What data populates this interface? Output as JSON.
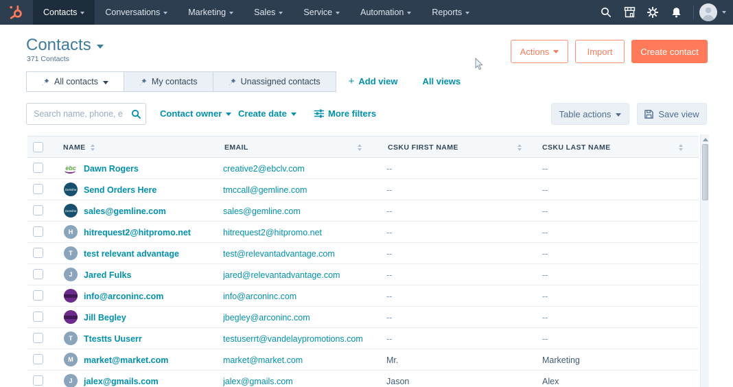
{
  "colors": {
    "nav_bg": "#2d3e50",
    "nav_active_bg": "#1e2d3c",
    "brand_orange": "#ff7a59",
    "link_teal": "#0091ae",
    "title_blue": "#3e7b9c",
    "header_text": "#33475b",
    "table_header_bg": "#f5f8fa"
  },
  "nav": {
    "items": [
      {
        "label": "Contacts",
        "active": true
      },
      {
        "label": "Conversations",
        "active": false
      },
      {
        "label": "Marketing",
        "active": false
      },
      {
        "label": "Sales",
        "active": false
      },
      {
        "label": "Service",
        "active": false
      },
      {
        "label": "Automation",
        "active": false
      },
      {
        "label": "Reports",
        "active": false
      }
    ],
    "right_icons": [
      "search-icon",
      "marketplace-icon",
      "settings-icon",
      "notifications-icon",
      "user-avatar"
    ]
  },
  "header": {
    "title": "Contacts",
    "subtitle": "371 Contacts",
    "actions_label": "Actions",
    "import_label": "Import",
    "create_label": "Create contact"
  },
  "tabs": {
    "items": [
      {
        "label": "All contacts",
        "active": true,
        "caret": true
      },
      {
        "label": "My contacts",
        "active": false,
        "caret": false
      },
      {
        "label": "Unassigned contacts",
        "active": false,
        "caret": false
      }
    ],
    "add_view_label": "Add view",
    "all_views_label": "All views"
  },
  "filters": {
    "search_placeholder": "Search name, phone, e",
    "contact_owner_label": "Contact owner",
    "create_date_label": "Create date",
    "more_filters_label": "More filters",
    "table_actions_label": "Table actions",
    "save_view_label": "Save view"
  },
  "table": {
    "columns": [
      "NAME",
      "EMAIL",
      "CSKU FIRST NAME",
      "CSKU LAST NAME"
    ],
    "rows": [
      {
        "name": "Dawn Rogers",
        "email": "creative2@ebclv.com",
        "first": "--",
        "last": "--",
        "avatar": {
          "type": "ebc",
          "text": "ebc"
        }
      },
      {
        "name": "Send Orders Here",
        "email": "tmccall@gemline.com",
        "first": "--",
        "last": "--",
        "avatar": {
          "type": "gemline",
          "text": "Gemline"
        }
      },
      {
        "name": "sales@gemline.com",
        "email": "sales@gemline.com",
        "first": "--",
        "last": "--",
        "avatar": {
          "type": "gemline",
          "text": "Gemline"
        }
      },
      {
        "name": "hitrequest2@hitpromo.net",
        "email": "hitrequest2@hitpromo.net",
        "first": "--",
        "last": "--",
        "avatar": {
          "type": "letter",
          "text": "H"
        }
      },
      {
        "name": "test relevant advantage",
        "email": "test@relevantadvantage.com",
        "first": "--",
        "last": "--",
        "avatar": {
          "type": "letter",
          "text": "T"
        }
      },
      {
        "name": "Jared Fulks",
        "email": "jared@relevantadvantage.com",
        "first": "--",
        "last": "--",
        "avatar": {
          "type": "letter",
          "text": "J"
        }
      },
      {
        "name": "info@arconinc.com",
        "email": "info@arconinc.com",
        "first": "--",
        "last": "--",
        "avatar": {
          "type": "arcon",
          "text": ""
        }
      },
      {
        "name": "Jill Begley",
        "email": "jbegley@arconinc.com",
        "first": "--",
        "last": "--",
        "avatar": {
          "type": "arcon",
          "text": ""
        }
      },
      {
        "name": "Ttestts Uuserr",
        "email": "testuserrt@vandelaypromotions.com",
        "first": "--",
        "last": "--",
        "avatar": {
          "type": "letter",
          "text": "T"
        }
      },
      {
        "name": "market@market.com",
        "email": "market@market.com",
        "first": "Mr.",
        "last": "Marketing",
        "avatar": {
          "type": "letter",
          "text": "M"
        }
      },
      {
        "name": "jalex@gmails.com",
        "email": "jalex@gmails.com",
        "first": "Jason",
        "last": "Alex",
        "avatar": {
          "type": "letter",
          "text": "J"
        }
      }
    ]
  }
}
